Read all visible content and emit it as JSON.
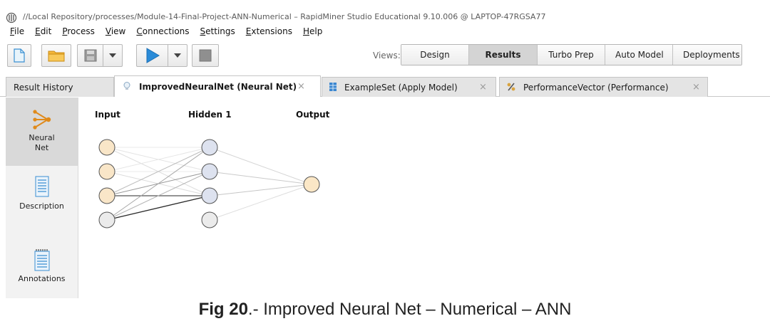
{
  "window": {
    "title": "//Local Repository/processes/Module-14-Final-Project-ANN-Numerical – RapidMiner Studio Educational 9.10.006 @ LAPTOP-47RGSA77"
  },
  "menu": [
    {
      "label": "File",
      "mnemonic": "F",
      "rest": "ile"
    },
    {
      "label": "Edit",
      "mnemonic": "E",
      "rest": "dit"
    },
    {
      "label": "Process",
      "mnemonic": "P",
      "rest": "rocess"
    },
    {
      "label": "View",
      "mnemonic": "V",
      "rest": "iew"
    },
    {
      "label": "Connections",
      "mnemonic": "C",
      "rest": "onnections"
    },
    {
      "label": "Settings",
      "mnemonic": "S",
      "rest": "ettings"
    },
    {
      "label": "Extensions",
      "mnemonic": "E",
      "rest": "xtensions"
    },
    {
      "label": "Help",
      "mnemonic": "H",
      "rest": "elp"
    }
  ],
  "toolbar": {
    "icons": [
      "new-process-icon",
      "open-folder-icon",
      "save-icon",
      "chevron-down-icon",
      "run-icon",
      "chevron-down-icon",
      "stop-icon"
    ],
    "views_label": "Views:",
    "views": [
      {
        "label": "Design",
        "active": false
      },
      {
        "label": "Results",
        "active": true
      },
      {
        "label": "Turbo Prep",
        "active": false
      },
      {
        "label": "Auto Model",
        "active": false
      },
      {
        "label": "Deployments",
        "active": false
      }
    ]
  },
  "tabs": [
    {
      "label": "Result History",
      "icon": null,
      "active": false
    },
    {
      "label": "ImprovedNeuralNet (Neural Net)",
      "icon": "lightbulb-icon",
      "active": true
    },
    {
      "label": "ExampleSet (Apply Model)",
      "icon": "table-icon",
      "active": false
    },
    {
      "label": "PerformanceVector (Performance)",
      "icon": "percent-icon",
      "active": false
    }
  ],
  "close_glyph": "×",
  "side_panel": [
    {
      "label_line1": "Neural",
      "label_line2": "Net",
      "icon": "neural-net-icon",
      "active": true
    },
    {
      "label_line1": "Description",
      "label_line2": "",
      "icon": "document-icon",
      "active": false
    },
    {
      "label_line1": "Annotations",
      "label_line2": "",
      "icon": "notepad-icon",
      "active": false
    }
  ],
  "network": {
    "layers": [
      {
        "label": "Input",
        "nodes": 4
      },
      {
        "label": "Hidden 1",
        "nodes": 4
      },
      {
        "label": "Output",
        "nodes": 1
      }
    ],
    "colors": {
      "input_fill": "#f9e6c8",
      "hidden_fill": "#dde2ef",
      "bias_fill": "#ebebeb",
      "output_fill": "#fbe7c6",
      "stroke": "#555555"
    }
  },
  "caption": {
    "fig": "Fig 20",
    "text": ".- Improved Neural Net – Numerical – ANN"
  }
}
